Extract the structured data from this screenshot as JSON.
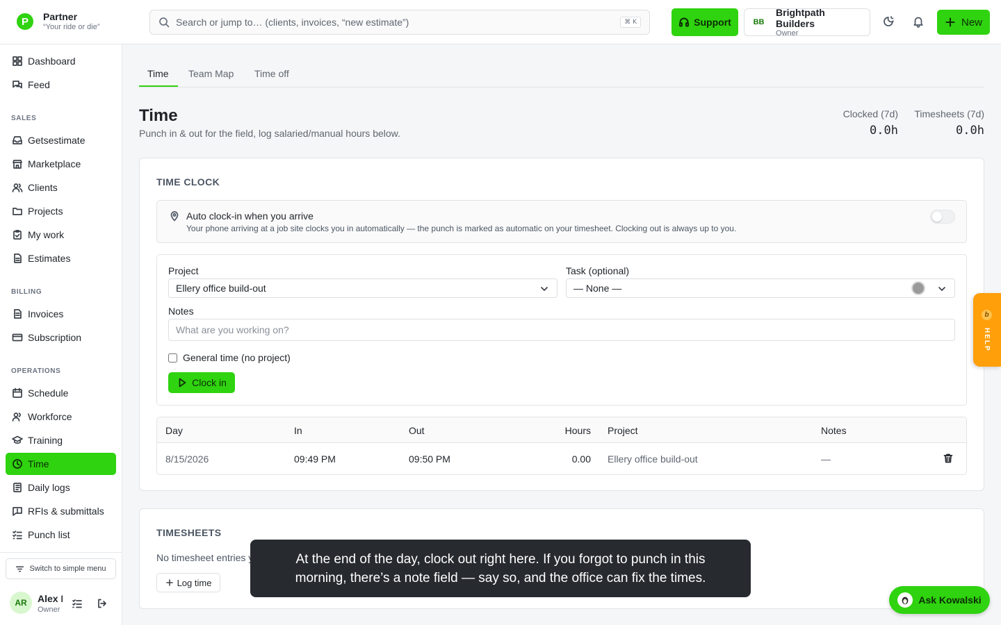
{
  "brand": {
    "name": "Partner",
    "tagline": "“Your ride or die”",
    "logo_letter": "P",
    "color": "#2fd30f"
  },
  "search": {
    "placeholder": "Search or jump to… (clients, invoices, “new estimate”)",
    "shortcut": "⌘ K"
  },
  "header": {
    "support_label": "Support",
    "org": {
      "initials": "BB",
      "name": "Brightpath Builders",
      "role": "Owner"
    },
    "new_label": "New"
  },
  "sidebar": {
    "top": [
      {
        "label": "Dashboard",
        "icon": "dashboard-icon"
      },
      {
        "label": "Feed",
        "icon": "feed-icon"
      }
    ],
    "sections": [
      {
        "title": "SALES",
        "items": [
          "Getsestimate",
          "Marketplace",
          "Clients",
          "Projects",
          "My work",
          "Estimates"
        ]
      },
      {
        "title": "BILLING",
        "items": [
          "Invoices",
          "Subscription"
        ]
      },
      {
        "title": "OPERATIONS",
        "items": [
          "Schedule",
          "Workforce",
          "Training",
          "Time",
          "Daily logs",
          "RFIs & submittals",
          "Punch list"
        ]
      }
    ],
    "active": "Time",
    "switch_label": "Switch to simple menu",
    "user": {
      "initials": "AR",
      "name": "Alex R",
      "role": "Owner"
    }
  },
  "tabs": [
    {
      "label": "Time"
    },
    {
      "label": "Team Map"
    },
    {
      "label": "Time off"
    }
  ],
  "page": {
    "title": "Time",
    "subtitle": "Punch in & out for the field, log salaried/manual hours below.",
    "stats": [
      {
        "label": "Clocked (7d)",
        "value": "0.0h"
      },
      {
        "label": "Timesheets (7d)",
        "value": "0.0h"
      }
    ]
  },
  "time_clock": {
    "title": "TIME CLOCK",
    "auto": {
      "title": "Auto clock-in when you arrive",
      "desc": "Your phone arriving at a job site clocks you in automatically — the punch is marked as automatic on your timesheet. Clocking out is always up to you.",
      "enabled": false
    },
    "project_label": "Project",
    "project_value": "Ellery office build-out",
    "task_label": "Task (optional)",
    "task_value": "— None —",
    "notes_label": "Notes",
    "notes_placeholder": "What are you working on?",
    "general_label": "General time (no project)",
    "clock_in_label": "Clock in"
  },
  "entries": {
    "columns": [
      "Day",
      "In",
      "Out",
      "Hours",
      "Project",
      "Notes"
    ],
    "rows": [
      {
        "day": "8/15/2026",
        "in": "09:49 PM",
        "out": "09:50 PM",
        "hours": "0.00",
        "project": "Ellery office build-out",
        "notes": "—"
      }
    ]
  },
  "timesheets": {
    "title": "TIMESHEETS",
    "empty": "No timesheet entries yet",
    "log_label": "Log time"
  },
  "tooltip": {
    "text": "At the end of the day, clock out right here. If you forgot to punch in this morning, there’s a note field — say so, and the office can fix the times."
  },
  "help": {
    "label": "HELP",
    "badge": "b"
  },
  "assistant": {
    "label": "Ask Kowalski"
  }
}
